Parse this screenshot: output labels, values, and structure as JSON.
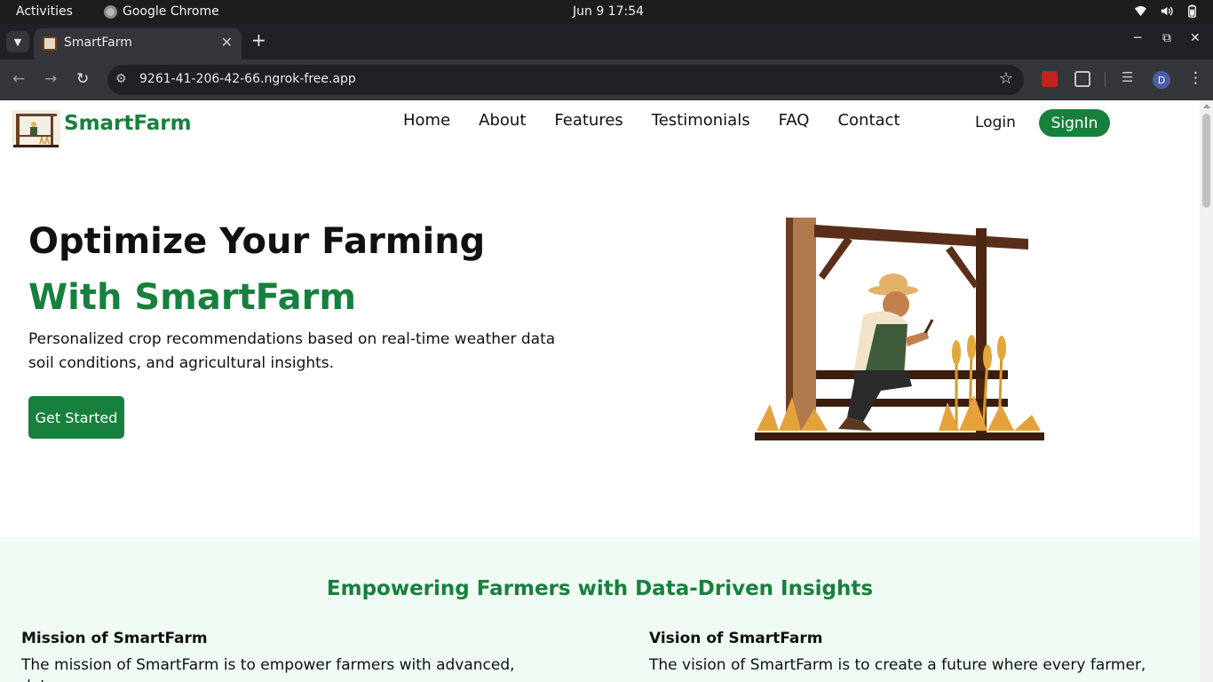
{
  "system": {
    "activities": "Activities",
    "app_name": "Google Chrome",
    "clock": "Jun 9  17:54"
  },
  "browser": {
    "tab_title": "SmartFarm",
    "url": "9261-41-206-42-66.ngrok-free.app",
    "profile_initial": "D"
  },
  "header": {
    "brand": "SmartFarm",
    "nav": [
      "Home",
      "About",
      "Features",
      "Testimonials",
      "FAQ",
      "Contact"
    ],
    "login": "Login",
    "signin": "SignIn"
  },
  "hero": {
    "title_line1": "Optimize Your Farming",
    "title_line2": "With SmartFarm",
    "description": "Personalized crop recommendations based on real-time weather data soil conditions, and agricultural insights.",
    "cta": "Get Started"
  },
  "about": {
    "title": "Empowering Farmers with Data-Driven Insights",
    "mission_title": "Mission of SmartFarm",
    "mission_text": "The mission of SmartFarm is to empower farmers with advanced, data-",
    "vision_title": "Vision of SmartFarm",
    "vision_text": "The vision of SmartFarm is to create a future where every farmer,"
  },
  "colors": {
    "brand_green": "#18803d",
    "section_bg": "#effbf3"
  }
}
